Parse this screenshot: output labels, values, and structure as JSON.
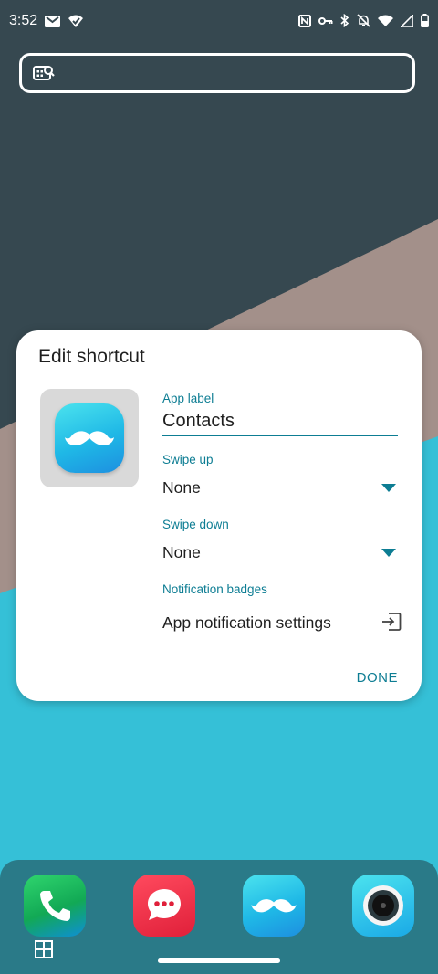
{
  "status_bar": {
    "time": "3:52",
    "left_icons": [
      "gmail-icon",
      "vpn-check-icon"
    ],
    "right_icons": [
      "nfc-icon",
      "key-icon",
      "bluetooth-icon",
      "bell-off-icon",
      "wifi-icon",
      "signal-icon",
      "battery-icon"
    ]
  },
  "search": {
    "placeholder": ""
  },
  "dialog": {
    "title": "Edit shortcut",
    "app_label": {
      "label": "App label",
      "value": "Contacts"
    },
    "swipe_up": {
      "label": "Swipe up",
      "value": "None"
    },
    "swipe_down": {
      "label": "Swipe down",
      "value": "None"
    },
    "notification_badges": {
      "label": "Notification badges",
      "action": "App notification settings"
    },
    "done": "DONE"
  },
  "dock": {
    "apps": [
      "phone-icon",
      "messages-icon",
      "contacts-icon",
      "camera-icon"
    ]
  },
  "colors": {
    "accent": "#0d7d93",
    "wallpaper_dark": "#364850",
    "wallpaper_mid": "#a3908a",
    "wallpaper_light": "#35bfd6"
  }
}
